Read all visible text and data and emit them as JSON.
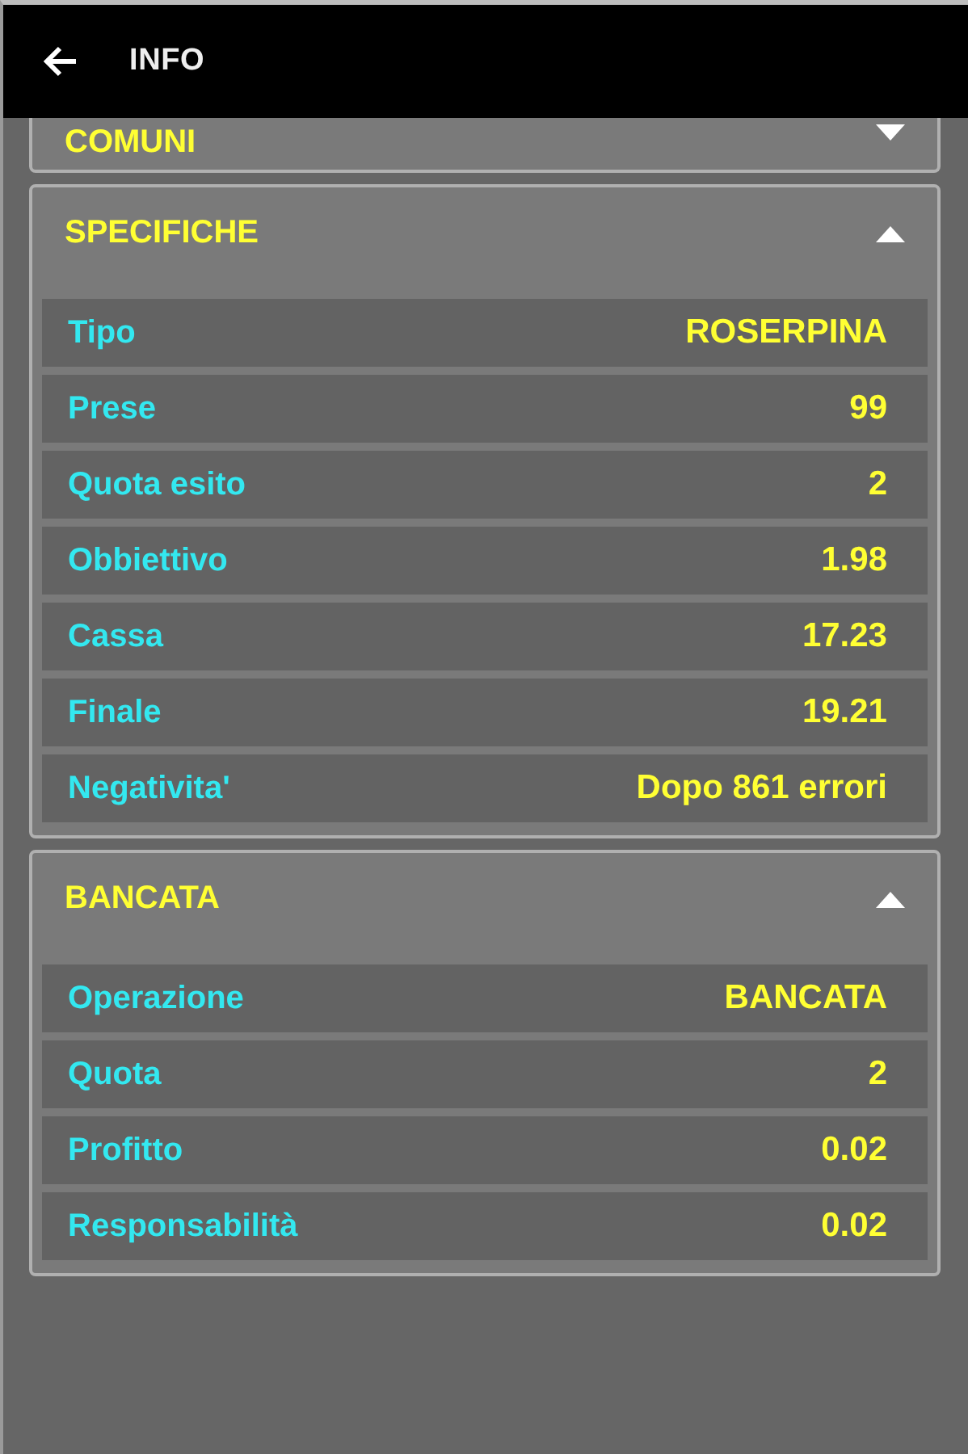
{
  "app_bar": {
    "title": "INFO"
  },
  "sections": [
    {
      "title": "COMUNI",
      "expanded": false
    },
    {
      "title": "SPECIFICHE",
      "expanded": true,
      "rows": [
        {
          "label": "Tipo",
          "value": "ROSERPINA"
        },
        {
          "label": "Prese",
          "value": "99"
        },
        {
          "label": "Quota esito",
          "value": "2"
        },
        {
          "label": "Obbiettivo",
          "value": "1.98"
        },
        {
          "label": "Cassa",
          "value": "17.23"
        },
        {
          "label": "Finale",
          "value": "19.21"
        },
        {
          "label": "Negativita'",
          "value": "Dopo 861 errori"
        }
      ]
    },
    {
      "title": "BANCATA",
      "expanded": true,
      "rows": [
        {
          "label": "Operazione",
          "value": "BANCATA"
        },
        {
          "label": "Quota",
          "value": "2"
        },
        {
          "label": "Profitto",
          "value": "0.02"
        },
        {
          "label": "Responsabilità",
          "value": "0.02"
        }
      ]
    }
  ]
}
